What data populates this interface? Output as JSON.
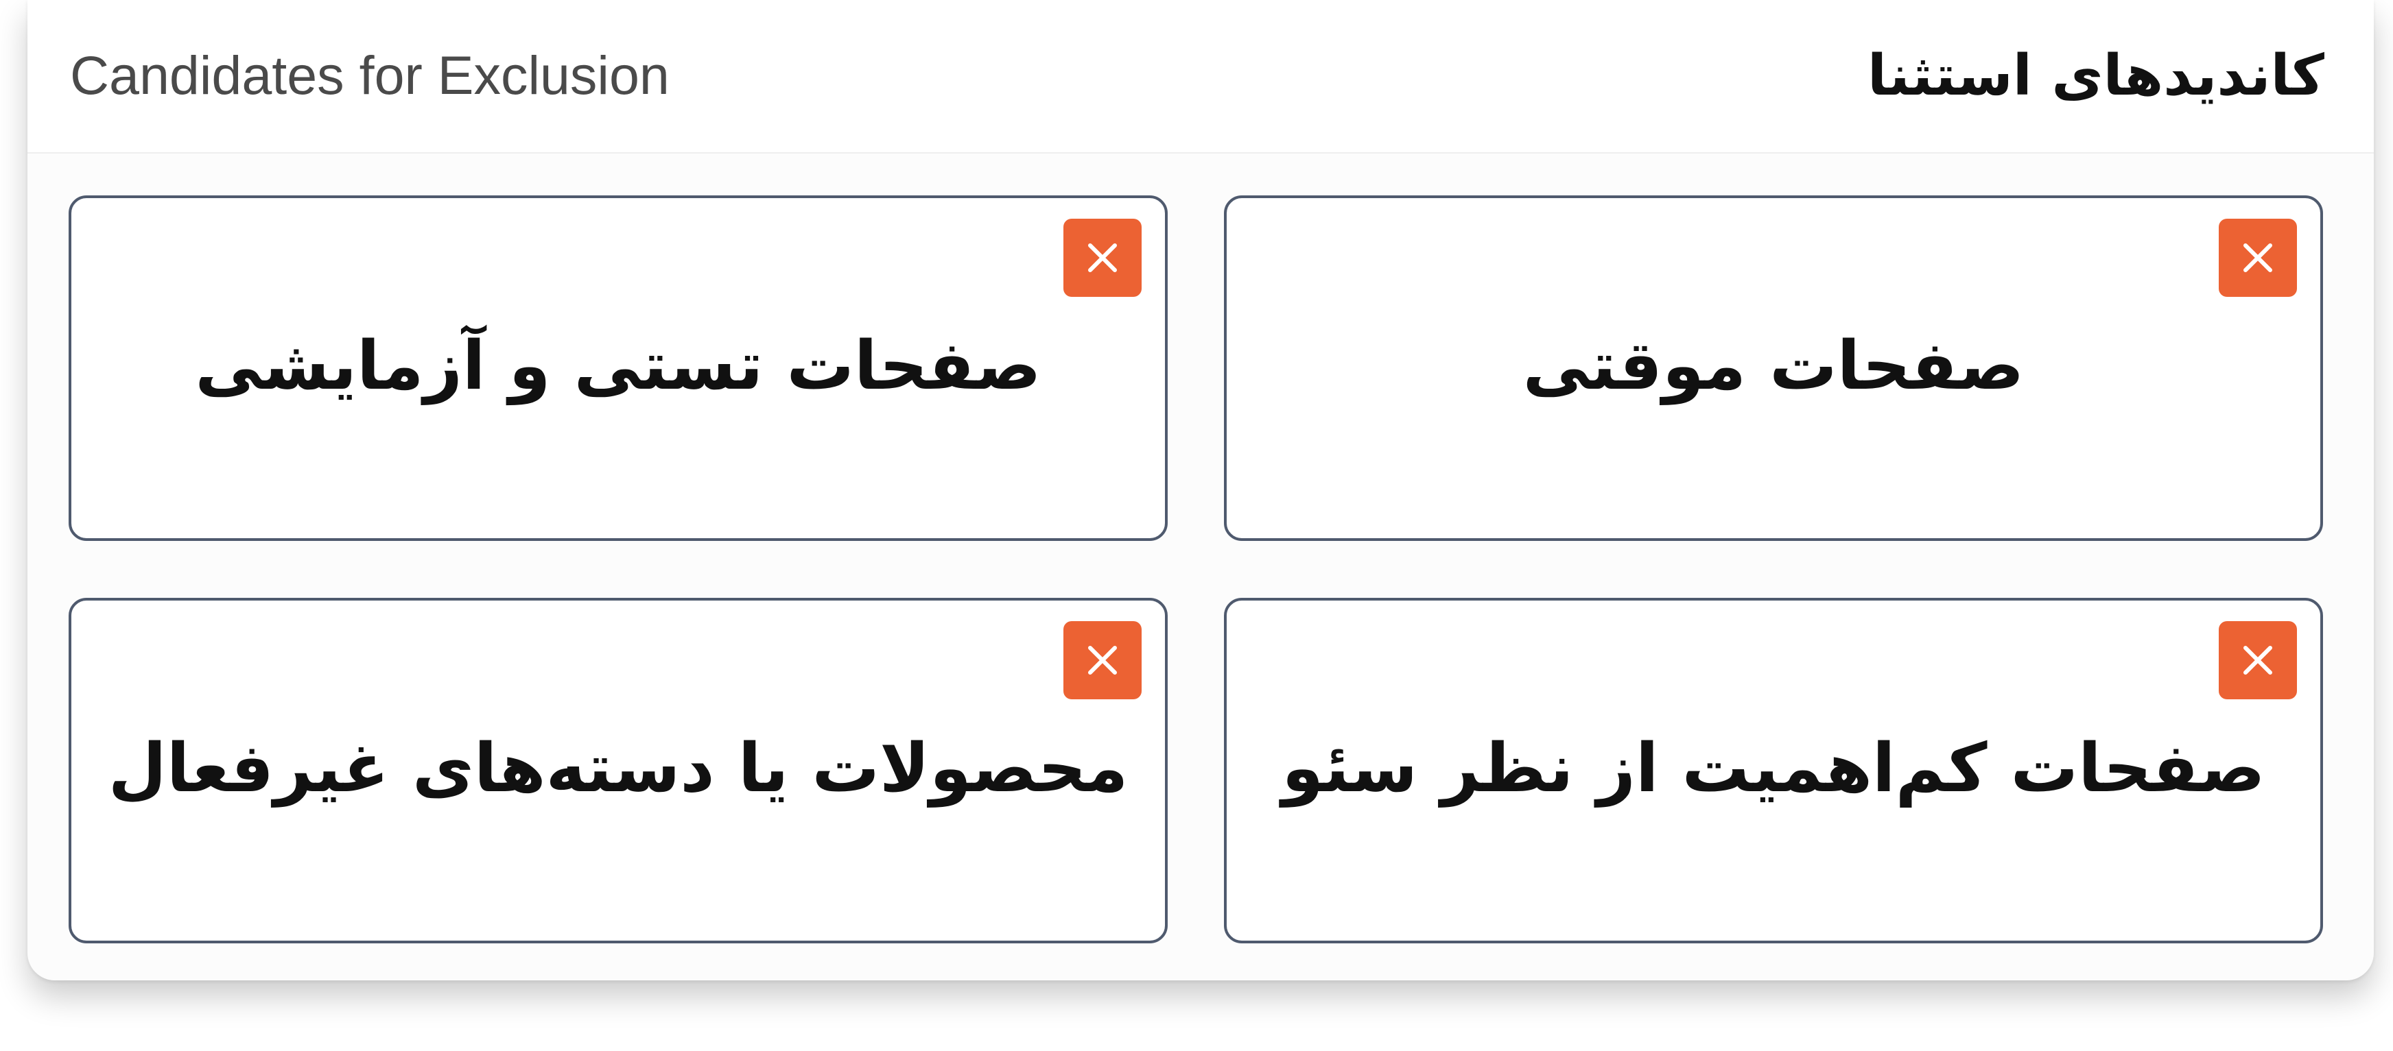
{
  "header": {
    "title_en": "Candidates for Exclusion",
    "title_fa": "کاندیدهای استثنا"
  },
  "cards": [
    {
      "label": "صفحات موقتی",
      "remove_icon": "close-icon"
    },
    {
      "label": "صفحات تستی و آزمایشی",
      "remove_icon": "close-icon"
    },
    {
      "label": "صفحات کم‌اهمیت از نظر سئو",
      "remove_icon": "close-icon"
    },
    {
      "label": "محصولات یا دسته‌های غیرفعال",
      "remove_icon": "close-icon"
    }
  ],
  "colors": {
    "remove_button": "#ec6233",
    "card_border": "#4f5a6e",
    "title_en": "#4a4a4a",
    "title_fa": "#111111"
  }
}
